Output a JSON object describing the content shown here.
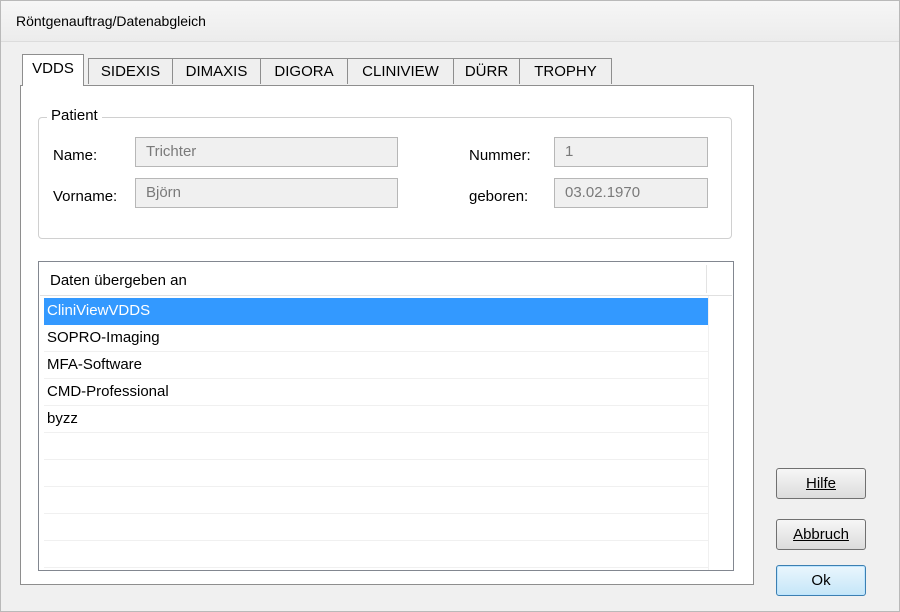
{
  "window": {
    "title": "Röntgenauftrag/Datenabgleich"
  },
  "tabs": [
    {
      "label": "VDDS",
      "active": true
    },
    {
      "label": "SIDEXIS"
    },
    {
      "label": "DIMAXIS"
    },
    {
      "label": "DIGORA"
    },
    {
      "label": "CLINIVIEW"
    },
    {
      "label": "DÜRR"
    },
    {
      "label": "TROPHY"
    }
  ],
  "patient": {
    "group_title": "Patient",
    "name_label": "Name:",
    "name_value": "Trichter",
    "vorname_label": "Vorname:",
    "vorname_value": "Björn",
    "nummer_label": "Nummer:",
    "nummer_value": "1",
    "geboren_label": "geboren:",
    "geboren_value": "03.02.1970"
  },
  "list": {
    "header": "Daten übergeben an",
    "items": [
      "CliniViewVDDS",
      "SOPRO-Imaging",
      "MFA-Software",
      "CMD-Professional",
      "byzz"
    ],
    "selected_index": 0
  },
  "buttons": {
    "help_label": "Hilfe",
    "cancel_label": "Abbruch",
    "ok_label": "Ok"
  },
  "colors": {
    "selection": "#3399ff",
    "default_button_border": "#3c7fb1"
  }
}
